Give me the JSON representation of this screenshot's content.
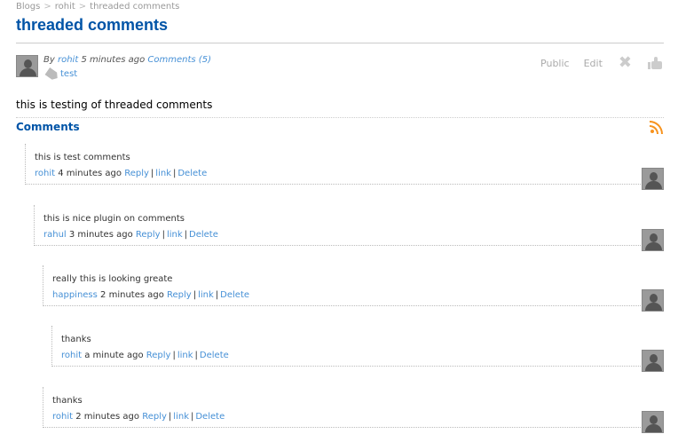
{
  "breadcrumb": {
    "items": [
      "Blogs",
      "rohit",
      "threaded comments"
    ],
    "separator": ">"
  },
  "post": {
    "title": "threaded comments",
    "by_prefix": "By",
    "author": "rohit",
    "time": "5 minutes ago",
    "comments_link": "Comments (5)",
    "tag": "test",
    "body": "this is testing of threaded comments"
  },
  "menu": {
    "access": "Public",
    "edit": "Edit"
  },
  "comments": {
    "heading": "Comments",
    "action_reply": "Reply",
    "action_link": "link",
    "action_delete": "Delete",
    "items": [
      {
        "text": "this is test comments",
        "author": "rohit",
        "time": "4 minutes ago",
        "depth": 0
      },
      {
        "text": "this is nice plugin on comments",
        "author": "rahul",
        "time": "3 minutes ago",
        "depth": 1
      },
      {
        "text": "really this is looking greate",
        "author": "happiness",
        "time": "2 minutes ago",
        "depth": 2
      },
      {
        "text": "thanks",
        "author": "rohit",
        "time": "a minute ago",
        "depth": 3
      },
      {
        "text": "thanks",
        "author": "rohit",
        "time": "2 minutes ago",
        "depth": 2
      }
    ]
  },
  "colors": {
    "title": "#0054a7",
    "link": "#4690d6",
    "rss": "#f7931e"
  }
}
